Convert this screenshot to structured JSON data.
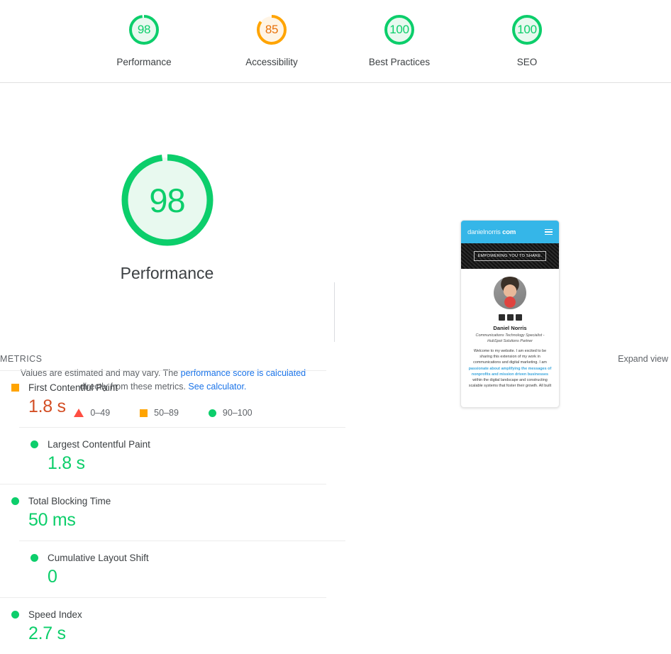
{
  "colors": {
    "green": "#0cce6b",
    "green_text": "#0cce6a",
    "green_fill": "#e8f9ef",
    "orange": "#ffa400",
    "orange_fill": "#fff4e5",
    "orange_text": "#e8710a",
    "red": "#ff4e42",
    "fcp_value": "#d34e24",
    "link": "#1a73e8",
    "gray_text": "#5f6368"
  },
  "category_scores": [
    {
      "score": 98,
      "label": "Performance",
      "status": "pass",
      "color": "#0cce6b",
      "fill": "#e8f9ef"
    },
    {
      "score": 85,
      "label": "Accessibility",
      "status": "average",
      "color": "#ffa400",
      "fill": "#fff4e5"
    },
    {
      "score": 100,
      "label": "Best Practices",
      "status": "pass",
      "color": "#0cce6b",
      "fill": "#e8f9ef"
    },
    {
      "score": 100,
      "label": "SEO",
      "status": "pass",
      "color": "#0cce6b",
      "fill": "#e8f9ef"
    }
  ],
  "main_score": {
    "value": 98,
    "title": "Performance",
    "color": "#0cce6b",
    "fill": "#e8f9ef"
  },
  "description": {
    "part1": "Values are estimated and may vary. The ",
    "link1": "performance score is calculated",
    "part2": " directly from these metrics. ",
    "link2": "See calculator."
  },
  "legend": [
    {
      "marker": "triangle-icon",
      "range": "0–49"
    },
    {
      "marker": "square-icon",
      "range": "50–89"
    },
    {
      "marker": "circle-icon",
      "range": "90–100"
    }
  ],
  "thumbnail": {
    "logo_light": "danielnorris",
    "logo_bold": "com",
    "menu_icon": "hamburger-icon",
    "hero_text": "EMPOWERING YOU TO SHARE.",
    "name": "Daniel Norris",
    "role_line1": "Communications Technology Specialist -",
    "role_line2": "HubSpot Solutions Partner",
    "para_before": "Welcome to my website. I am excited to be sharing this extension of my work in communications and digital marketing. I am ",
    "para_highlight": "passionate about amplifying the messages of nonprofits and mission driven businesses",
    "para_after": " within the digital landscape and constructing scalable systems that foster their growth. All built"
  },
  "metrics_section": {
    "title": "METRICS",
    "expand_label": "Expand view"
  },
  "metrics": [
    {
      "name": "First Contentful Paint",
      "value": "1.8 s",
      "status": "average",
      "marker": "square-icon",
      "value_color": "#d34e24"
    },
    {
      "name": "Largest Contentful Paint",
      "value": "1.8 s",
      "status": "pass",
      "marker": "circle-icon",
      "value_color": "#0cce6a"
    },
    {
      "name": "Total Blocking Time",
      "value": "50 ms",
      "status": "pass",
      "marker": "circle-icon",
      "value_color": "#0cce6a"
    },
    {
      "name": "Cumulative Layout Shift",
      "value": "0",
      "status": "pass",
      "marker": "circle-icon",
      "value_color": "#0cce6a"
    },
    {
      "name": "Speed Index",
      "value": "2.7 s",
      "status": "pass",
      "marker": "circle-icon",
      "value_color": "#0cce6a"
    }
  ]
}
